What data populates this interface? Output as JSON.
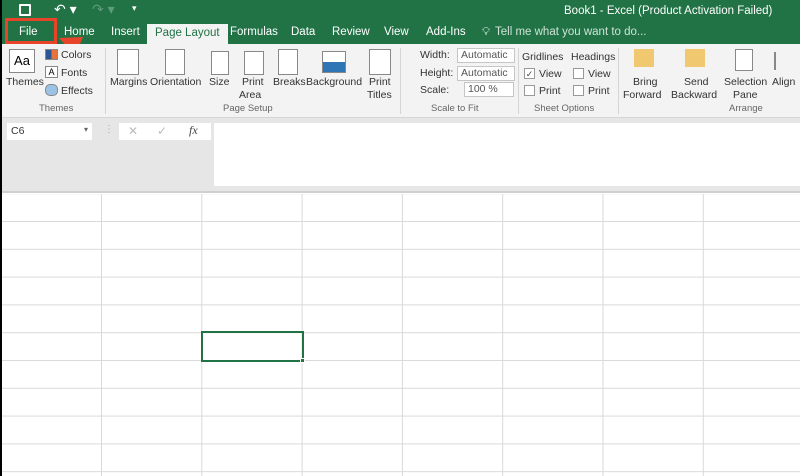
{
  "title": "Book1 - Excel (Product Activation Failed)",
  "tabs": [
    "File",
    "Home",
    "Insert",
    "Page Layout",
    "Formulas",
    "Data",
    "Review",
    "View",
    "Add-Ins"
  ],
  "tell_me": "Tell me what you want to do...",
  "themes": {
    "themes": "Themes",
    "colors": "Colors",
    "fonts": "Fonts",
    "effects": "Effects",
    "group": "Themes"
  },
  "page_setup": {
    "margins": "Margins",
    "orientation": "Orientation",
    "size": "Size",
    "print_area_1": "Print",
    "print_area_2": "Area",
    "breaks": "Breaks",
    "background": "Background",
    "print_titles_1": "Print",
    "print_titles_2": "Titles",
    "group": "Page Setup"
  },
  "scale": {
    "width_label": "Width:",
    "width_value": "Automatic",
    "height_label": "Height:",
    "height_value": "Automatic",
    "scale_label": "Scale:",
    "scale_value": "100 %",
    "group": "Scale to Fit"
  },
  "sheet_options": {
    "gridlines": "Gridlines",
    "headings": "Headings",
    "view": "View",
    "print": "Print",
    "group": "Sheet Options",
    "gridlines_view": true,
    "gridlines_print": false,
    "headings_view": false,
    "headings_print": false
  },
  "arrange": {
    "bring_1": "Bring",
    "bring_2": "Forward",
    "send_1": "Send",
    "send_2": "Backward",
    "sel_1": "Selection",
    "sel_2": "Pane",
    "align": "Align",
    "group": "Arrange"
  },
  "name_box": "C6",
  "fx": "fx",
  "colors": {
    "accent": "#217346",
    "annotation": "#e8442a"
  }
}
